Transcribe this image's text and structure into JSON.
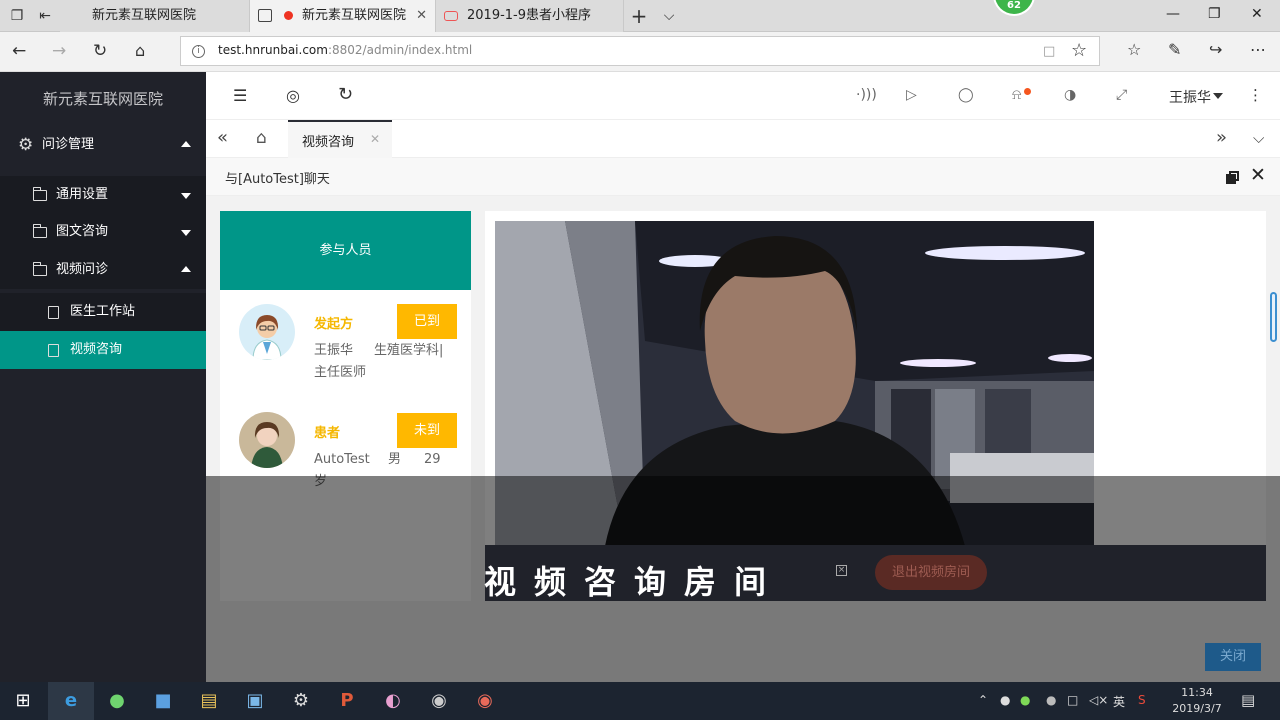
{
  "browser": {
    "tabs": [
      {
        "title": "新元素互联网医院"
      },
      {
        "title": "新元素互联网医院"
      },
      {
        "title": "2019-1-9患者小程序"
      }
    ],
    "profile_badge": "62",
    "url_host": "test.hnrunbai.com",
    "url_rest": ":8802/admin/index.html"
  },
  "sidebar": {
    "title": "新元素互联网医院",
    "group": "问诊管理",
    "items": [
      {
        "label": "通用设置"
      },
      {
        "label": "图文咨询"
      },
      {
        "label": "视频问诊"
      }
    ],
    "subitems": [
      {
        "label": "医生工作站"
      },
      {
        "label": "视频咨询"
      }
    ]
  },
  "header": {
    "user_name": "王振华"
  },
  "page_tabs": [
    {
      "label": "视频咨询"
    }
  ],
  "dialog": {
    "title": "与[AutoTest]聊天",
    "participants_title": "参与人员",
    "participants": [
      {
        "role": "发起方",
        "status": "已到",
        "name": "王振华",
        "dept": "生殖医学科|",
        "title": "主任医师"
      },
      {
        "role": "患者",
        "status": "未到",
        "name": "AutoTest",
        "gender": "男",
        "age": "29",
        "age_unit": "岁"
      }
    ],
    "room_title": "视频咨询房间",
    "room_close_glyph": "×",
    "exit_button": "退出视频房间",
    "close_button": "关闭"
  },
  "taskbar": {
    "time": "11:34",
    "date": "2019/3/7",
    "ime": "英"
  },
  "colors": {
    "sidebar_bg": "#20222a",
    "accent": "#009688",
    "status_badge": "#ffb800",
    "role_text": "#f5b700"
  }
}
